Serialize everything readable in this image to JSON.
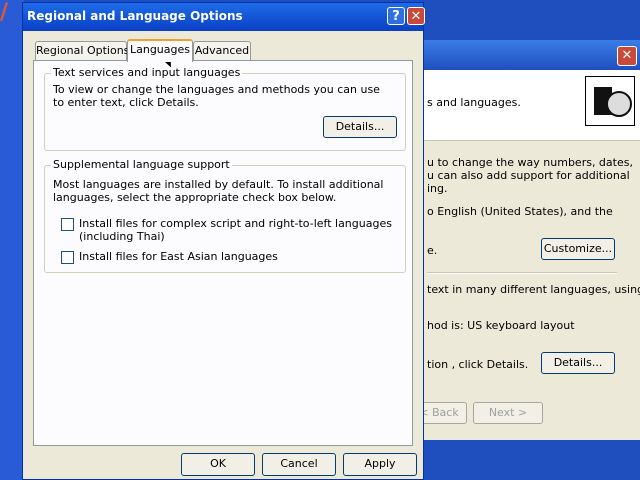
{
  "dialog": {
    "title": "Regional and Language Options",
    "help_icon": "?",
    "close_icon": "✕",
    "tabs": [
      {
        "label": "Regional Options",
        "active": false
      },
      {
        "label": "Languages",
        "active": true
      },
      {
        "label": "Advanced",
        "active": false
      }
    ],
    "text_services": {
      "legend": "Text services and input languages",
      "description": "To view or change the languages and methods you can use to enter text, click Details.",
      "details_label": "Details..."
    },
    "supplemental": {
      "legend": "Supplemental language support",
      "description": "Most languages are installed by default. To install additional languages, select the appropriate check box below.",
      "complex_script_label": "Install files for complex script and right-to-left languages (including Thai)",
      "complex_script_checked": false,
      "east_asian_label": "Install files for East Asian languages",
      "east_asian_checked": false
    },
    "buttons": {
      "ok": "OK",
      "cancel": "Cancel",
      "apply": "Apply"
    }
  },
  "background_window": {
    "close_icon": "✕",
    "header_text": "s and languages.",
    "line1": "u to change the way numbers, dates,",
    "line2": "u can also add support for additional",
    "line3": "ing.",
    "line4": "o English (United States), and the",
    "line5": "e.",
    "customize_label": "Customize...",
    "line6": "text in many different languages, using",
    "line7": "hod is: US keyboard layout",
    "line8": "tion , click Details.",
    "details_label": "Details...",
    "back_label": "< Back",
    "next_label": "Next >"
  }
}
